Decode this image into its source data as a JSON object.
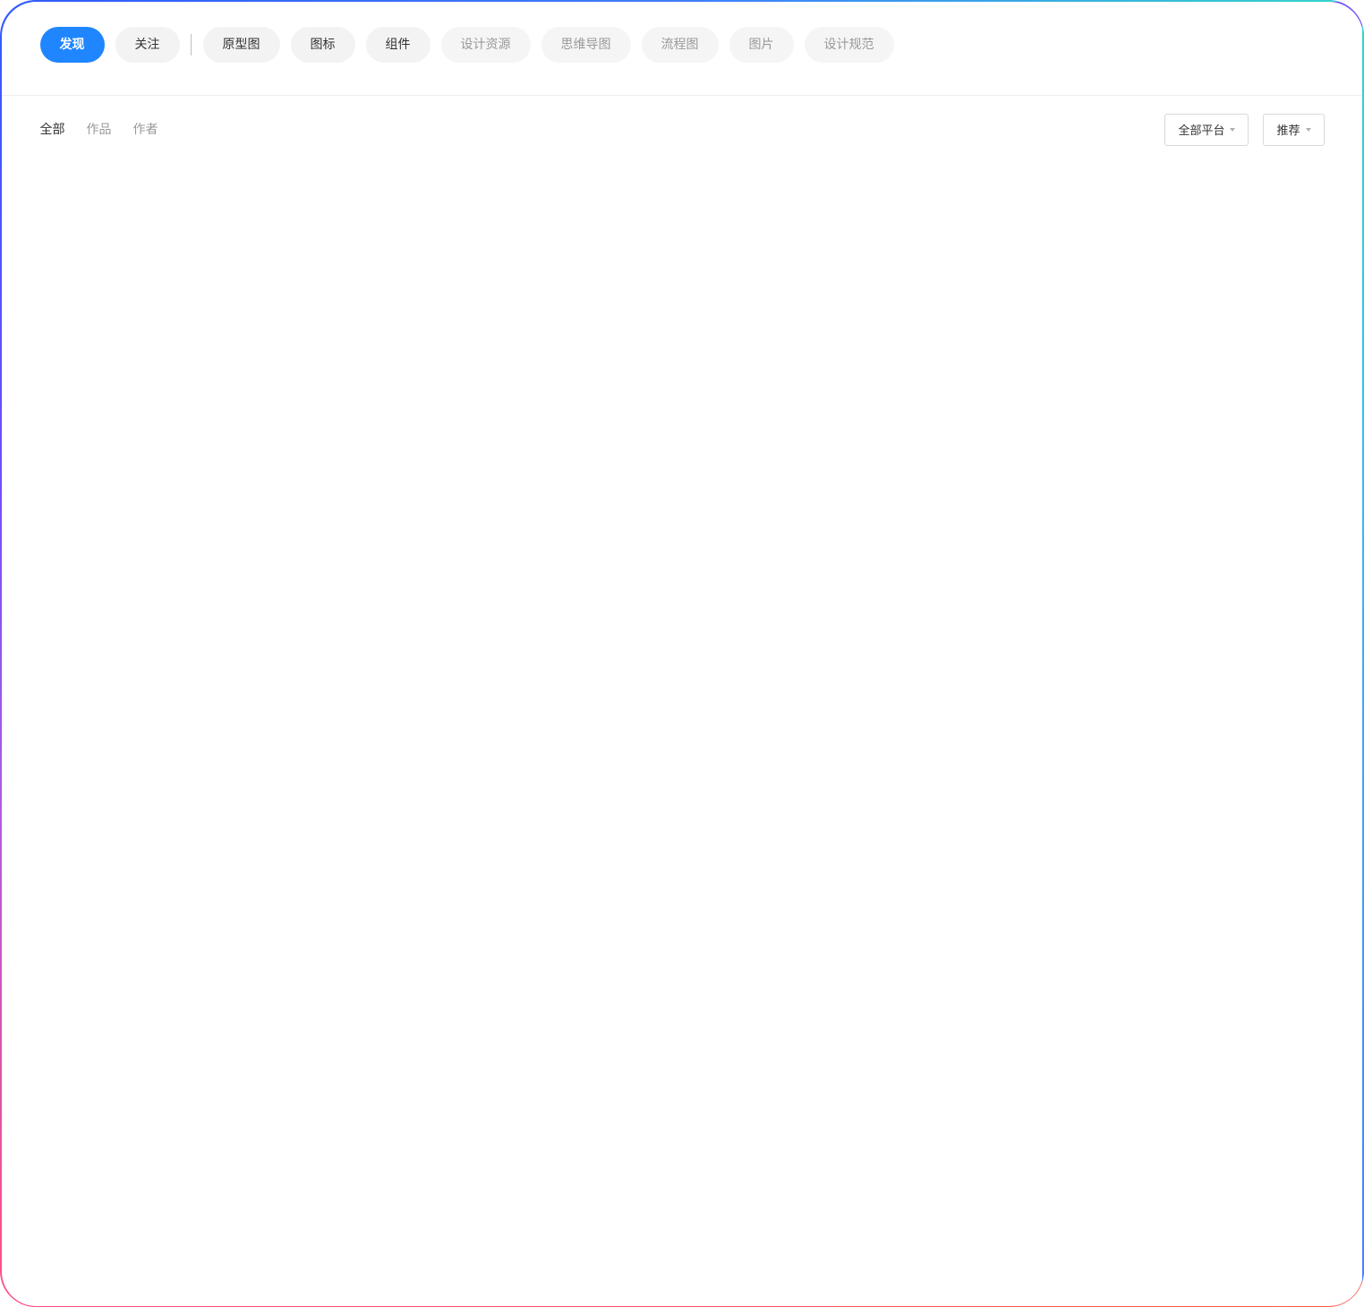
{
  "categories": {
    "primary": [
      {
        "label": "发现",
        "state": "active"
      },
      {
        "label": "关注",
        "state": "normal"
      }
    ],
    "secondary": [
      {
        "label": "原型图",
        "state": "normal"
      },
      {
        "label": "图标",
        "state": "normal"
      },
      {
        "label": "组件",
        "state": "normal"
      },
      {
        "label": "设计资源",
        "state": "muted"
      },
      {
        "label": "思维导图",
        "state": "muted"
      },
      {
        "label": "流程图",
        "state": "muted"
      },
      {
        "label": "图片",
        "state": "muted"
      },
      {
        "label": "设计规范",
        "state": "muted"
      }
    ]
  },
  "filters": {
    "tabs": [
      {
        "label": "全部",
        "active": true
      },
      {
        "label": "作品",
        "active": false
      },
      {
        "label": "作者",
        "active": false
      }
    ],
    "platform_dropdown": {
      "label": "全部平台",
      "icon": "caret-down-icon"
    },
    "sort_dropdown": {
      "label": "推荐",
      "icon": "caret-down-icon"
    }
  },
  "colors": {
    "accent": "#1f86ff",
    "pill_bg": "#f3f3f3",
    "text_primary": "#333333",
    "text_muted": "#999999"
  }
}
